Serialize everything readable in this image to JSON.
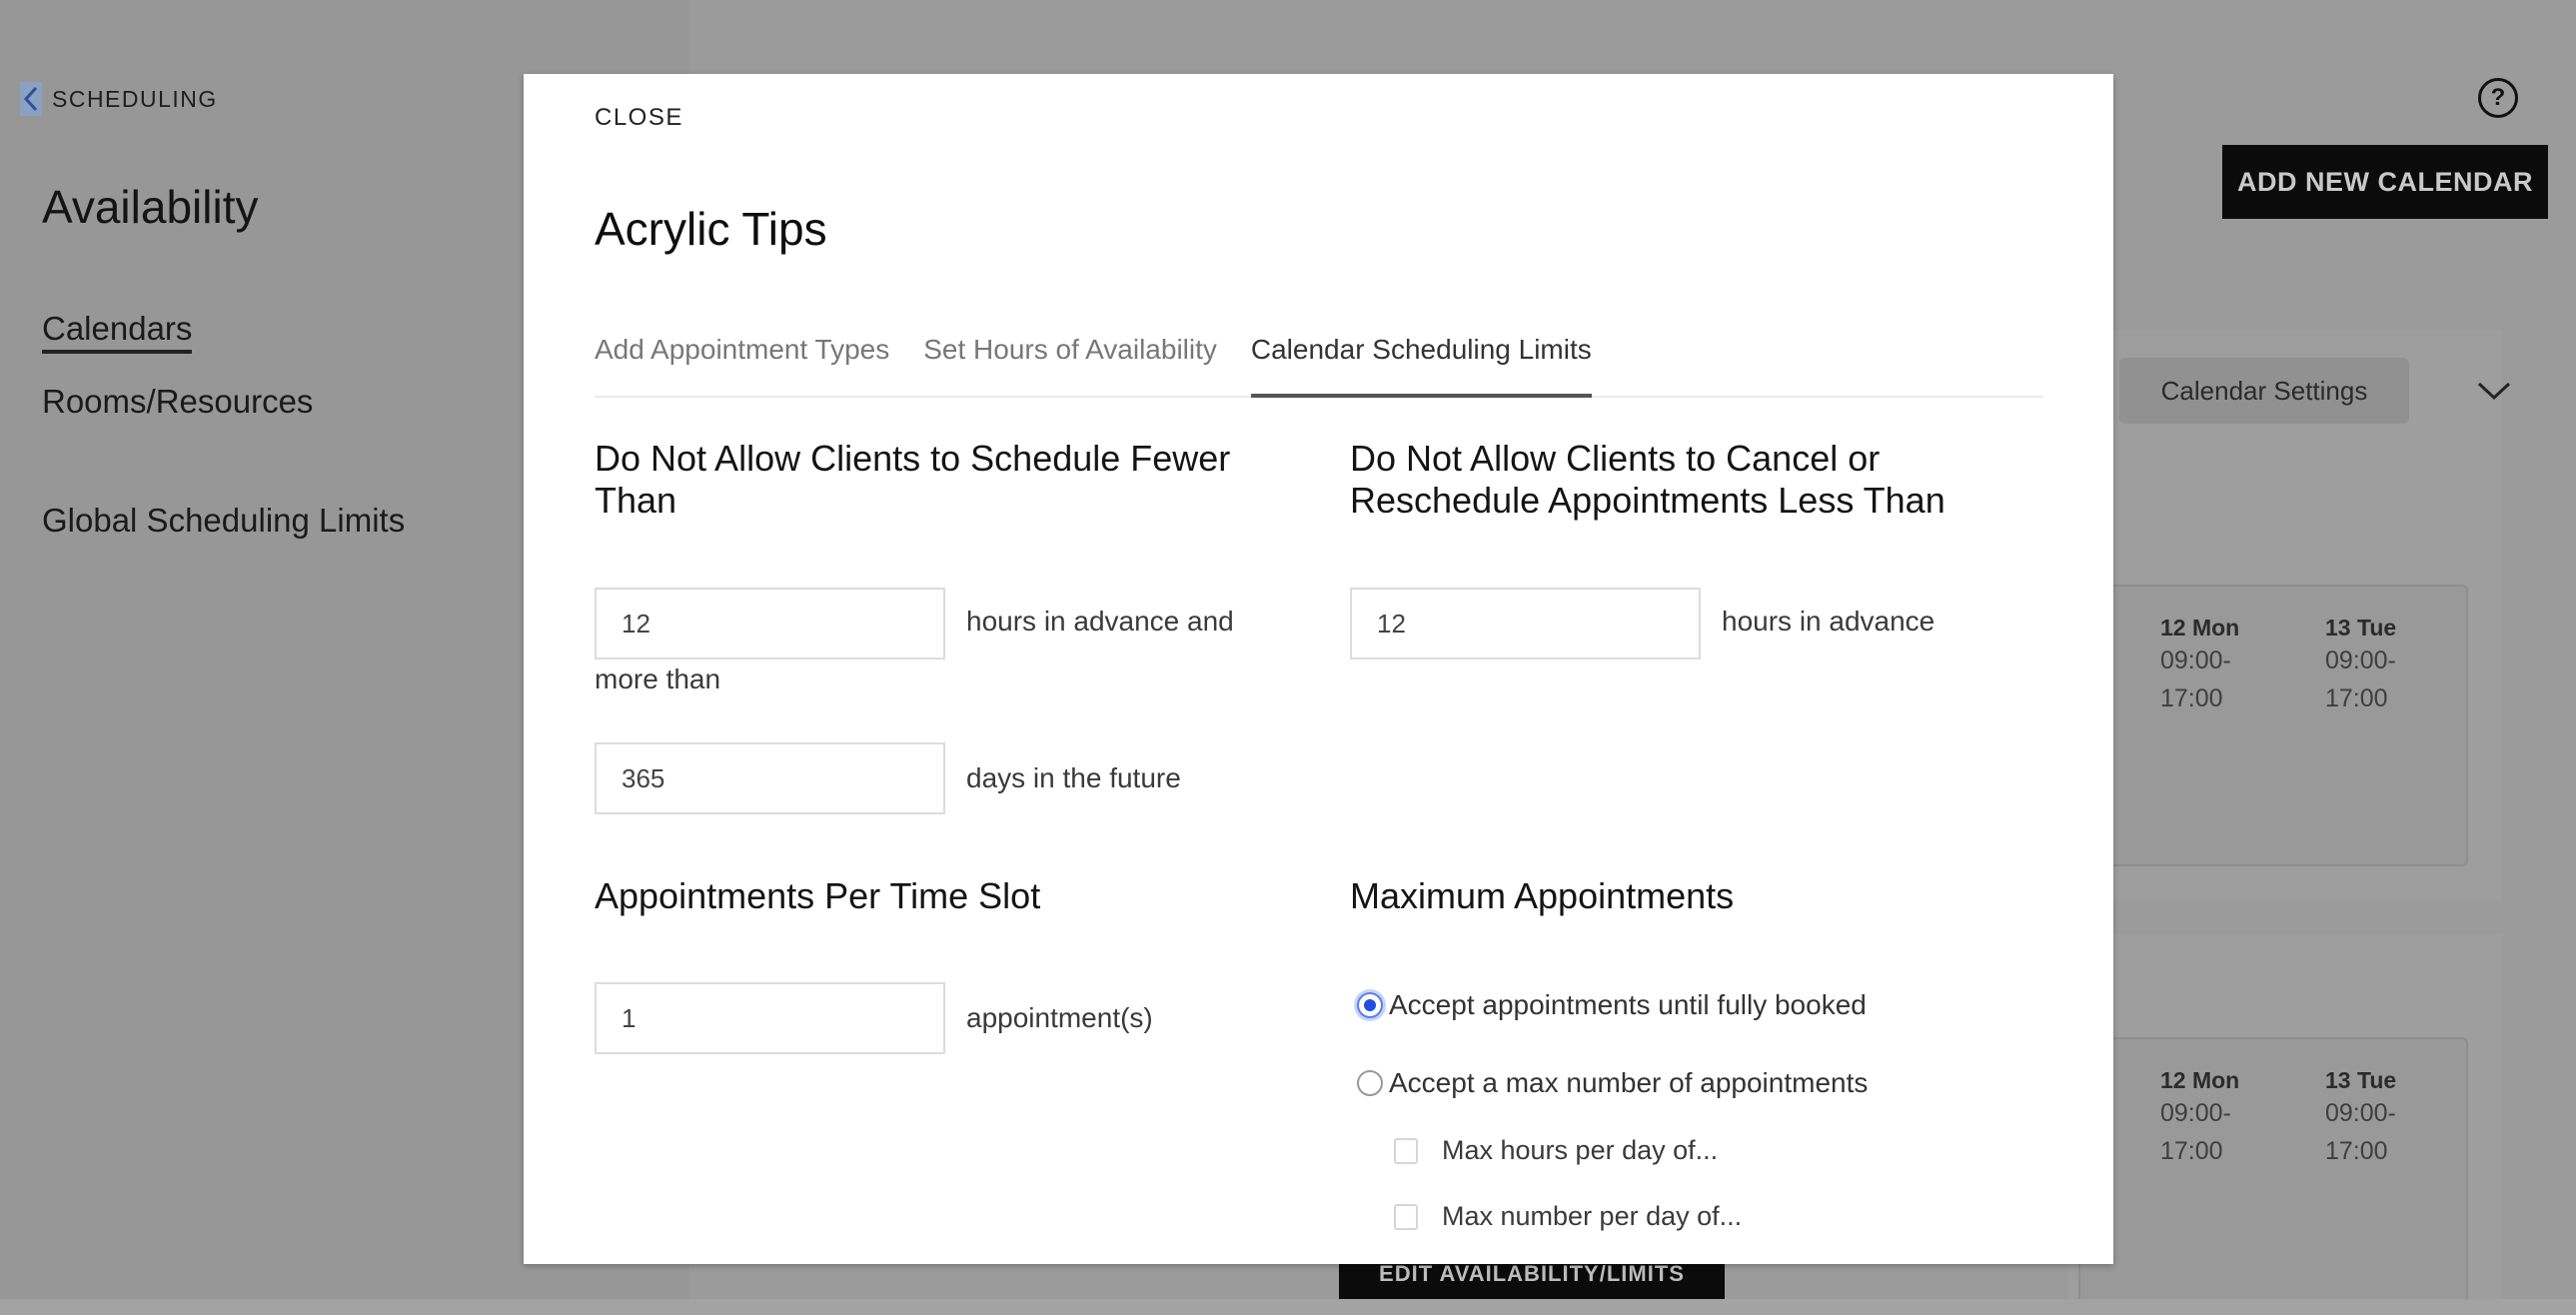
{
  "sidebar": {
    "back_label": "SCHEDULING",
    "title": "Availability",
    "items": [
      {
        "label": "Calendars",
        "active": true
      },
      {
        "label": "Rooms/Resources",
        "active": false
      },
      {
        "label": "Global Scheduling Limits",
        "active": false
      }
    ]
  },
  "header": {
    "help_icon": "?",
    "add_calendar_label": "ADD NEW CALENDAR"
  },
  "calendar_panel": {
    "settings_label": "Calendar Settings",
    "cards": [
      {
        "days": [
          {
            "day": "12 Mon",
            "hours": [
              "09:00-",
              "17:00"
            ]
          },
          {
            "day": "13 Tue",
            "hours": [
              "09:00-",
              "17:00"
            ]
          }
        ]
      },
      {
        "days": [
          {
            "day": "12 Mon",
            "hours": [
              "09:00-",
              "17:00"
            ]
          },
          {
            "day": "13 Tue",
            "hours": [
              "09:00-",
              "17:00"
            ]
          }
        ]
      }
    ],
    "edit_label": "EDIT AVAILABILITY/LIMITS"
  },
  "modal": {
    "close_label": "CLOSE",
    "title": "Acrylic Tips",
    "tabs": [
      {
        "label": "Add Appointment Types",
        "active": false
      },
      {
        "label": "Set Hours of Availability",
        "active": false
      },
      {
        "label": "Calendar Scheduling Limits",
        "active": true
      }
    ],
    "schedule_limit": {
      "heading": "Do Not Allow Clients to Schedule Fewer Than",
      "min_hours_value": "12",
      "min_hours_suffix": "hours in advance and",
      "between_label": "more than",
      "max_days_value": "365",
      "max_days_suffix": "days in the future"
    },
    "cancel_limit": {
      "heading": "Do Not Allow Clients to Cancel or Reschedule Appointments Less Than",
      "hours_value": "12",
      "hours_suffix": "hours in advance"
    },
    "per_slot": {
      "heading": "Appointments Per Time Slot",
      "value": "1",
      "suffix": "appointment(s)"
    },
    "max_appointments": {
      "heading": "Maximum Appointments",
      "options": [
        {
          "label": "Accept appointments until fully booked",
          "selected": true
        },
        {
          "label": "Accept a max number of appointments",
          "selected": false
        }
      ],
      "checkboxes": [
        {
          "label": "Max hours per day of...",
          "checked": false
        },
        {
          "label": "Max number per day of...",
          "checked": false
        }
      ]
    }
  },
  "colors": {
    "accent_radio": "#1f4ee0",
    "primary_button": "#0b0b0b",
    "overlay": "#9a9a9a"
  }
}
